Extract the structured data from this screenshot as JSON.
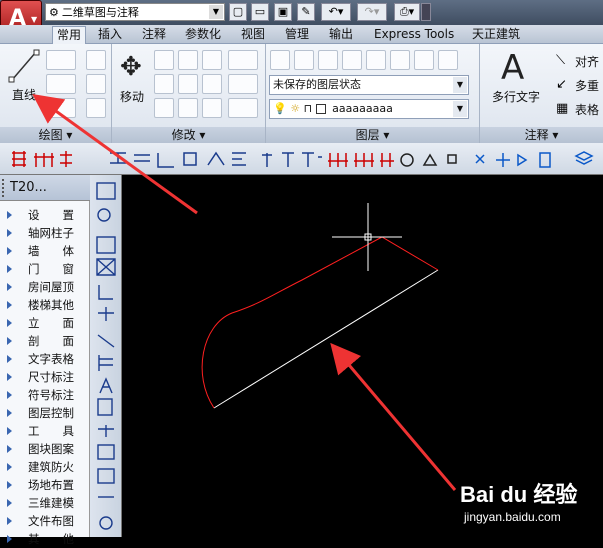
{
  "titlebar": {
    "workspace": "二维草图与注释",
    "app_icon": "A"
  },
  "tabs": [
    "常用",
    "插入",
    "注释",
    "参数化",
    "视图",
    "管理",
    "输出",
    "Express Tools",
    "天正建筑"
  ],
  "ribbon": {
    "draw": {
      "line_label": "直线",
      "panel_label": "绘图 ▾"
    },
    "modify": {
      "move_label": "移动",
      "panel_label": "修改 ▾"
    },
    "layers": {
      "layer_state": "未保存的图层状态",
      "layer_name": "aaaaaaaaa",
      "panel_label": "图层 ▾"
    },
    "annotation": {
      "mtext_label": "多行文字",
      "mtext_icon": "A",
      "align_label": "对齐",
      "multileader_label": "多重",
      "table_label": "表格",
      "panel_label": "注释 ▾"
    }
  },
  "tianzheng_panel": {
    "title": "T20...",
    "items": [
      "设　　置",
      "轴网柱子",
      "墙　　体",
      "门　　窗",
      "房间屋顶",
      "楼梯其他",
      "立　　面",
      "剖　　面",
      "文字表格",
      "尺寸标注",
      "符号标注",
      "图层控制",
      "工　　具",
      "图块图案",
      "建筑防火",
      "场地布置",
      "三维建模",
      "文件布图",
      "其　　他"
    ]
  },
  "watermark": {
    "text": "Bai du 经验",
    "url": "jingyan.baidu.com"
  },
  "colors": {
    "accent_red": "#ee3333",
    "line_white": "#ffffff",
    "line_red": "#ff2020"
  }
}
